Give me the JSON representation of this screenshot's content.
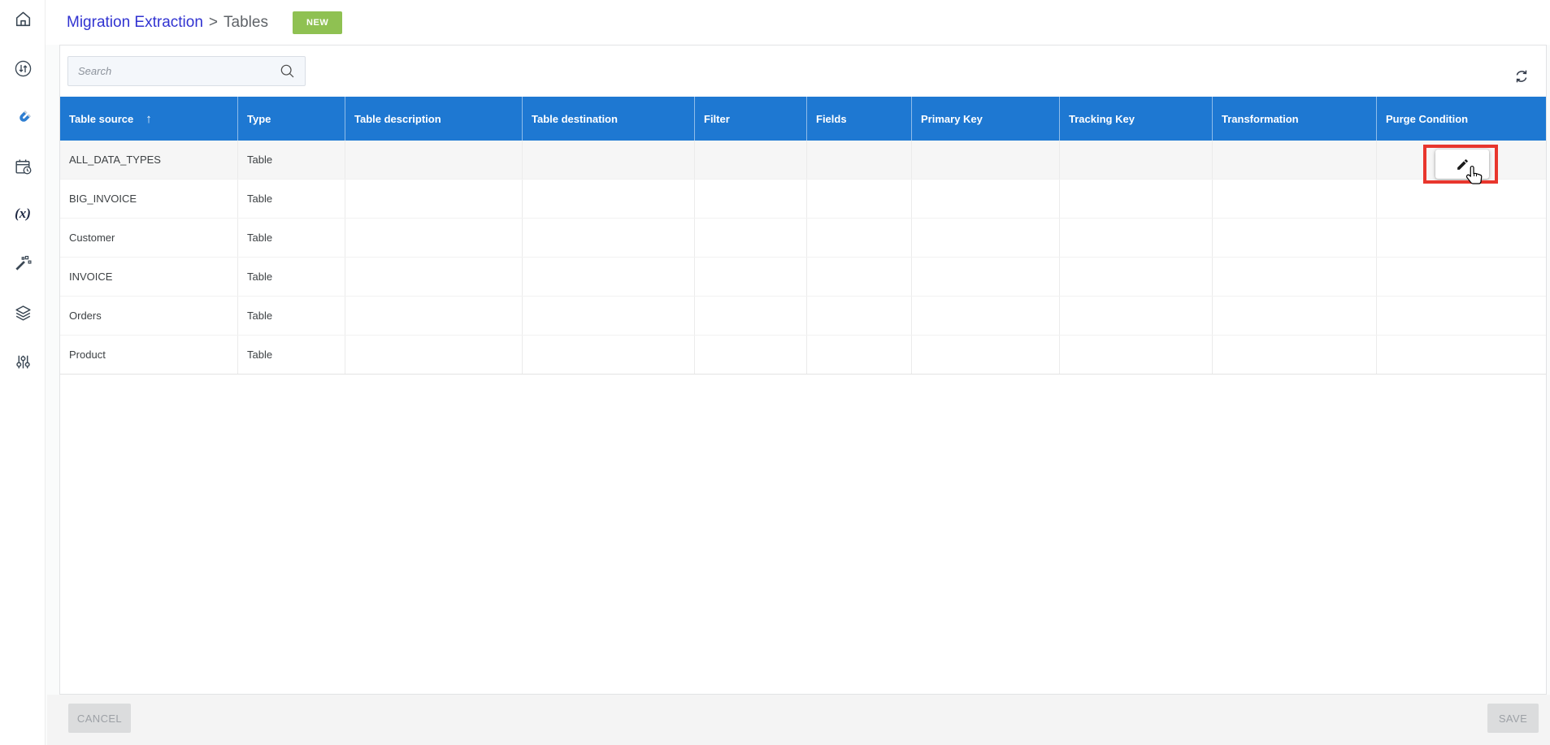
{
  "colors": {
    "header-blue": "#1e78d2",
    "breadcrumb-blue": "#3133d1",
    "new-green": "#8fc152",
    "annotation-red": "#e8362d",
    "magnet-blue": "#2e7ed1"
  },
  "sidebar": {
    "items": [
      {
        "icon": "home-icon"
      },
      {
        "icon": "sync-arrows-icon"
      },
      {
        "icon": "magnet-icon",
        "active": true
      },
      {
        "icon": "calendar-clock-icon"
      },
      {
        "icon": "function-icon",
        "glyph": "(x)"
      },
      {
        "icon": "magic-wand-icon"
      },
      {
        "icon": "layers-icon"
      },
      {
        "icon": "sliders-icon"
      }
    ]
  },
  "breadcrumb": {
    "link": "Migration Extraction",
    "separator": ">",
    "current": "Tables"
  },
  "toolbar": {
    "new_label": "NEW"
  },
  "search": {
    "placeholder": "Search"
  },
  "table": {
    "headers": [
      "Table source",
      "Type",
      "Table description",
      "Table destination",
      "Filter",
      "Fields",
      "Primary Key",
      "Tracking Key",
      "Transformation",
      "Purge Condition"
    ],
    "sort": {
      "column": "Table source",
      "direction": "ascending",
      "icon": "↑"
    },
    "rows": [
      {
        "table_source": "ALL_DATA_TYPES",
        "type": "Table",
        "table_description": "",
        "table_destination": "",
        "filter": "",
        "fields": "",
        "primary_key": "",
        "tracking_key": "",
        "transformation": "",
        "purge_condition": ""
      },
      {
        "table_source": "BIG_INVOICE",
        "type": "Table",
        "table_description": "",
        "table_destination": "",
        "filter": "",
        "fields": "",
        "primary_key": "",
        "tracking_key": "",
        "transformation": "",
        "purge_condition": ""
      },
      {
        "table_source": "Customer",
        "type": "Table",
        "table_description": "",
        "table_destination": "",
        "filter": "",
        "fields": "",
        "primary_key": "",
        "tracking_key": "",
        "transformation": "",
        "purge_condition": ""
      },
      {
        "table_source": "INVOICE",
        "type": "Table",
        "table_description": "",
        "table_destination": "",
        "filter": "",
        "fields": "",
        "primary_key": "",
        "tracking_key": "",
        "transformation": "",
        "purge_condition": ""
      },
      {
        "table_source": "Orders",
        "type": "Table",
        "table_description": "",
        "table_destination": "",
        "filter": "",
        "fields": "",
        "primary_key": "",
        "tracking_key": "",
        "transformation": "",
        "purge_condition": ""
      },
      {
        "table_source": "Product",
        "type": "Table",
        "table_description": "",
        "table_destination": "",
        "filter": "",
        "fields": "",
        "primary_key": "",
        "tracking_key": "",
        "transformation": "",
        "purge_condition": ""
      }
    ]
  },
  "annotation": {
    "highlighted_control": "edit-purge-condition-button",
    "row": "ALL_DATA_TYPES"
  },
  "footer": {
    "cancel_label": "CANCEL",
    "save_label": "SAVE"
  }
}
